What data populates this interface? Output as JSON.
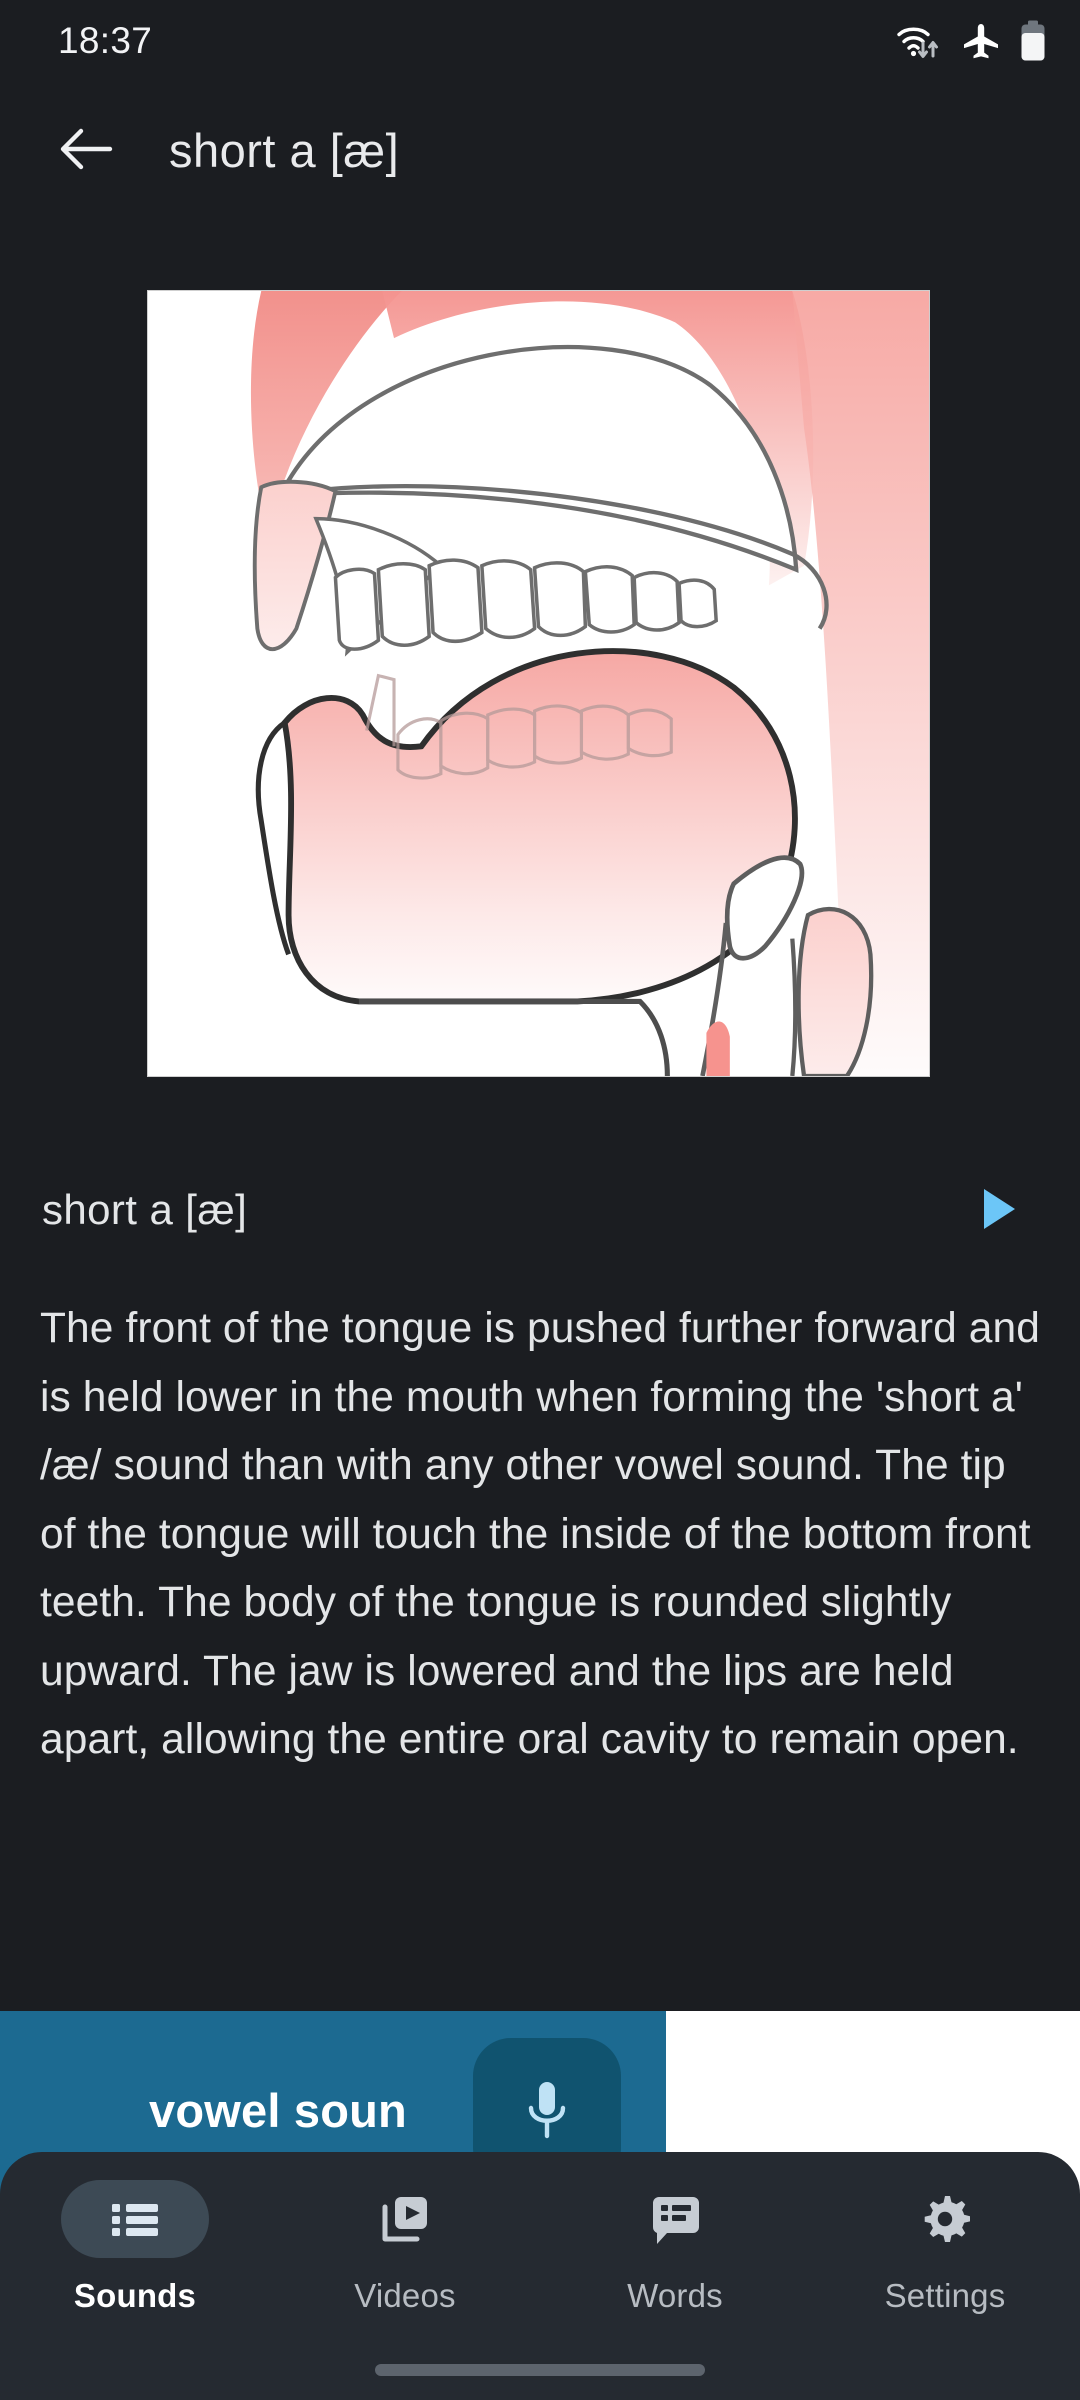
{
  "statusbar": {
    "time": "18:37",
    "icons": [
      {
        "name": "wifi-icon",
        "label": "wifi-with-data-arrows"
      },
      {
        "name": "airplane-mode-icon",
        "label": "airplane-mode"
      },
      {
        "name": "battery-icon",
        "label": "battery"
      }
    ]
  },
  "appbar": {
    "back_label": "back-arrow",
    "title": "short a  [æ]"
  },
  "diagram": {
    "alt": "sagittal-cross-section-of-mouth-showing-tongue-position-for-short-a",
    "colors": {
      "background": "#ffffff",
      "tissue_pink": "#f59a9a",
      "outline": "#5a5a5a"
    }
  },
  "sound": {
    "label": "short a  [æ]",
    "play_label": "play-sound",
    "play_color": "#6cc6f7"
  },
  "description": {
    "text": "The front of the tongue is pushed further forward and is held lower in the mouth when forming the 'short a' /æ/ sound than with any other vowel sound. The tip of the tongue will touch the inside of the bottom front teeth. The body of the tongue is rounded slightly upward. The jaw is lowered and the lips are held apart, allowing the entire oral cavity to remain open."
  },
  "ad": {
    "text": "vowel soun",
    "mic_label": "microphone-search",
    "blue": "#1c6a91",
    "mic_bg": "#10536f"
  },
  "bottom_nav": {
    "items": [
      {
        "label": "Sounds",
        "icon": "list-icon",
        "active": true
      },
      {
        "label": "Videos",
        "icon": "video-library-icon",
        "active": false
      },
      {
        "label": "Words",
        "icon": "speech-bubble-list-icon",
        "active": false
      },
      {
        "label": "Settings",
        "icon": "gear-icon",
        "active": false
      }
    ]
  }
}
